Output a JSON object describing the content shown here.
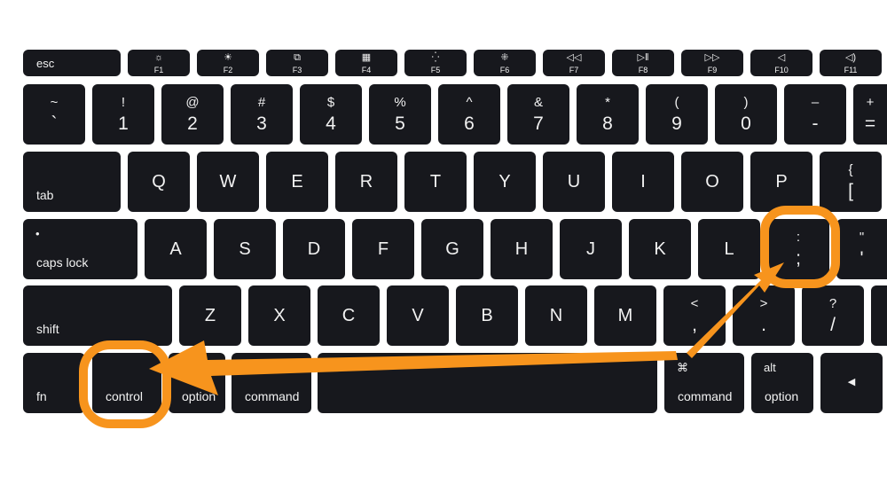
{
  "annotation_color": "#F7941D",
  "key_color": "#17181d",
  "rows": [
    [
      {
        "type": "esc",
        "label": "esc"
      },
      {
        "type": "fkey",
        "label": "F1",
        "icon": "brightness-down-icon"
      },
      {
        "type": "fkey",
        "label": "F2",
        "icon": "brightness-up-icon"
      },
      {
        "type": "fkey",
        "label": "F3",
        "icon": "mission-control-icon"
      },
      {
        "type": "fkey",
        "label": "F4",
        "icon": "launchpad-icon"
      },
      {
        "type": "fkey",
        "label": "F5",
        "icon": "keyboard-light-down-icon"
      },
      {
        "type": "fkey",
        "label": "F6",
        "icon": "keyboard-light-up-icon"
      },
      {
        "type": "fkey",
        "label": "F7",
        "icon": "rewind-icon"
      },
      {
        "type": "fkey",
        "label": "F8",
        "icon": "play-pause-icon"
      },
      {
        "type": "fkey",
        "label": "F9",
        "icon": "fast-forward-icon"
      },
      {
        "type": "fkey",
        "label": "F10",
        "icon": "mute-icon"
      },
      {
        "type": "fkey",
        "label": "F11",
        "icon": "volume-down-icon"
      }
    ],
    [
      {
        "type": "dual",
        "top": "~",
        "bottom": "`"
      },
      {
        "type": "dual",
        "top": "!",
        "bottom": "1"
      },
      {
        "type": "dual",
        "top": "@",
        "bottom": "2"
      },
      {
        "type": "dual",
        "top": "#",
        "bottom": "3"
      },
      {
        "type": "dual",
        "top": "$",
        "bottom": "4"
      },
      {
        "type": "dual",
        "top": "%",
        "bottom": "5"
      },
      {
        "type": "dual",
        "top": "^",
        "bottom": "6"
      },
      {
        "type": "dual",
        "top": "&",
        "bottom": "7"
      },
      {
        "type": "dual",
        "top": "*",
        "bottom": "8"
      },
      {
        "type": "dual",
        "top": "(",
        "bottom": "9"
      },
      {
        "type": "dual",
        "top": ")",
        "bottom": "0"
      },
      {
        "type": "dual",
        "top": "–",
        "bottom": "-"
      },
      {
        "type": "dual",
        "top": "+",
        "bottom": "="
      }
    ],
    [
      {
        "type": "mod",
        "label": "tab"
      },
      {
        "type": "letter",
        "label": "Q"
      },
      {
        "type": "letter",
        "label": "W"
      },
      {
        "type": "letter",
        "label": "E"
      },
      {
        "type": "letter",
        "label": "R"
      },
      {
        "type": "letter",
        "label": "T"
      },
      {
        "type": "letter",
        "label": "Y"
      },
      {
        "type": "letter",
        "label": "U"
      },
      {
        "type": "letter",
        "label": "I"
      },
      {
        "type": "letter",
        "label": "O"
      },
      {
        "type": "letter",
        "label": "P"
      },
      {
        "type": "dual",
        "top": "{",
        "bottom": "["
      }
    ],
    [
      {
        "type": "mod",
        "label": "caps lock",
        "top": "•"
      },
      {
        "type": "letter",
        "label": "A"
      },
      {
        "type": "letter",
        "label": "S"
      },
      {
        "type": "letter",
        "label": "D"
      },
      {
        "type": "letter",
        "label": "F"
      },
      {
        "type": "letter",
        "label": "G"
      },
      {
        "type": "letter",
        "label": "H"
      },
      {
        "type": "letter",
        "label": "J"
      },
      {
        "type": "letter",
        "label": "K"
      },
      {
        "type": "letter",
        "label": "L"
      },
      {
        "type": "dual",
        "top": ":",
        "bottom": ";"
      },
      {
        "type": "dual",
        "top": "\"",
        "bottom": "'"
      }
    ],
    [
      {
        "type": "mod",
        "label": "shift"
      },
      {
        "type": "letter",
        "label": "Z"
      },
      {
        "type": "letter",
        "label": "X"
      },
      {
        "type": "letter",
        "label": "C"
      },
      {
        "type": "letter",
        "label": "V"
      },
      {
        "type": "letter",
        "label": "B"
      },
      {
        "type": "letter",
        "label": "N"
      },
      {
        "type": "letter",
        "label": "M"
      },
      {
        "type": "dual",
        "top": "<",
        "bottom": ","
      },
      {
        "type": "dual",
        "top": ">",
        "bottom": "."
      },
      {
        "type": "dual",
        "top": "?",
        "bottom": "/"
      },
      {
        "type": "mod",
        "label": ""
      }
    ],
    [
      {
        "type": "mod",
        "label": "fn"
      },
      {
        "type": "mod",
        "label": "control",
        "highlight": true
      },
      {
        "type": "mod",
        "label": "option"
      },
      {
        "type": "mod",
        "label": "command",
        "top": "⌘",
        "variant": "cmdl"
      },
      {
        "type": "space",
        "label": ""
      },
      {
        "type": "mod",
        "label": "command",
        "top": "⌘"
      },
      {
        "type": "mod",
        "label": "option",
        "top": "alt"
      },
      {
        "type": "arrowkey",
        "label": "◀"
      }
    ]
  ]
}
